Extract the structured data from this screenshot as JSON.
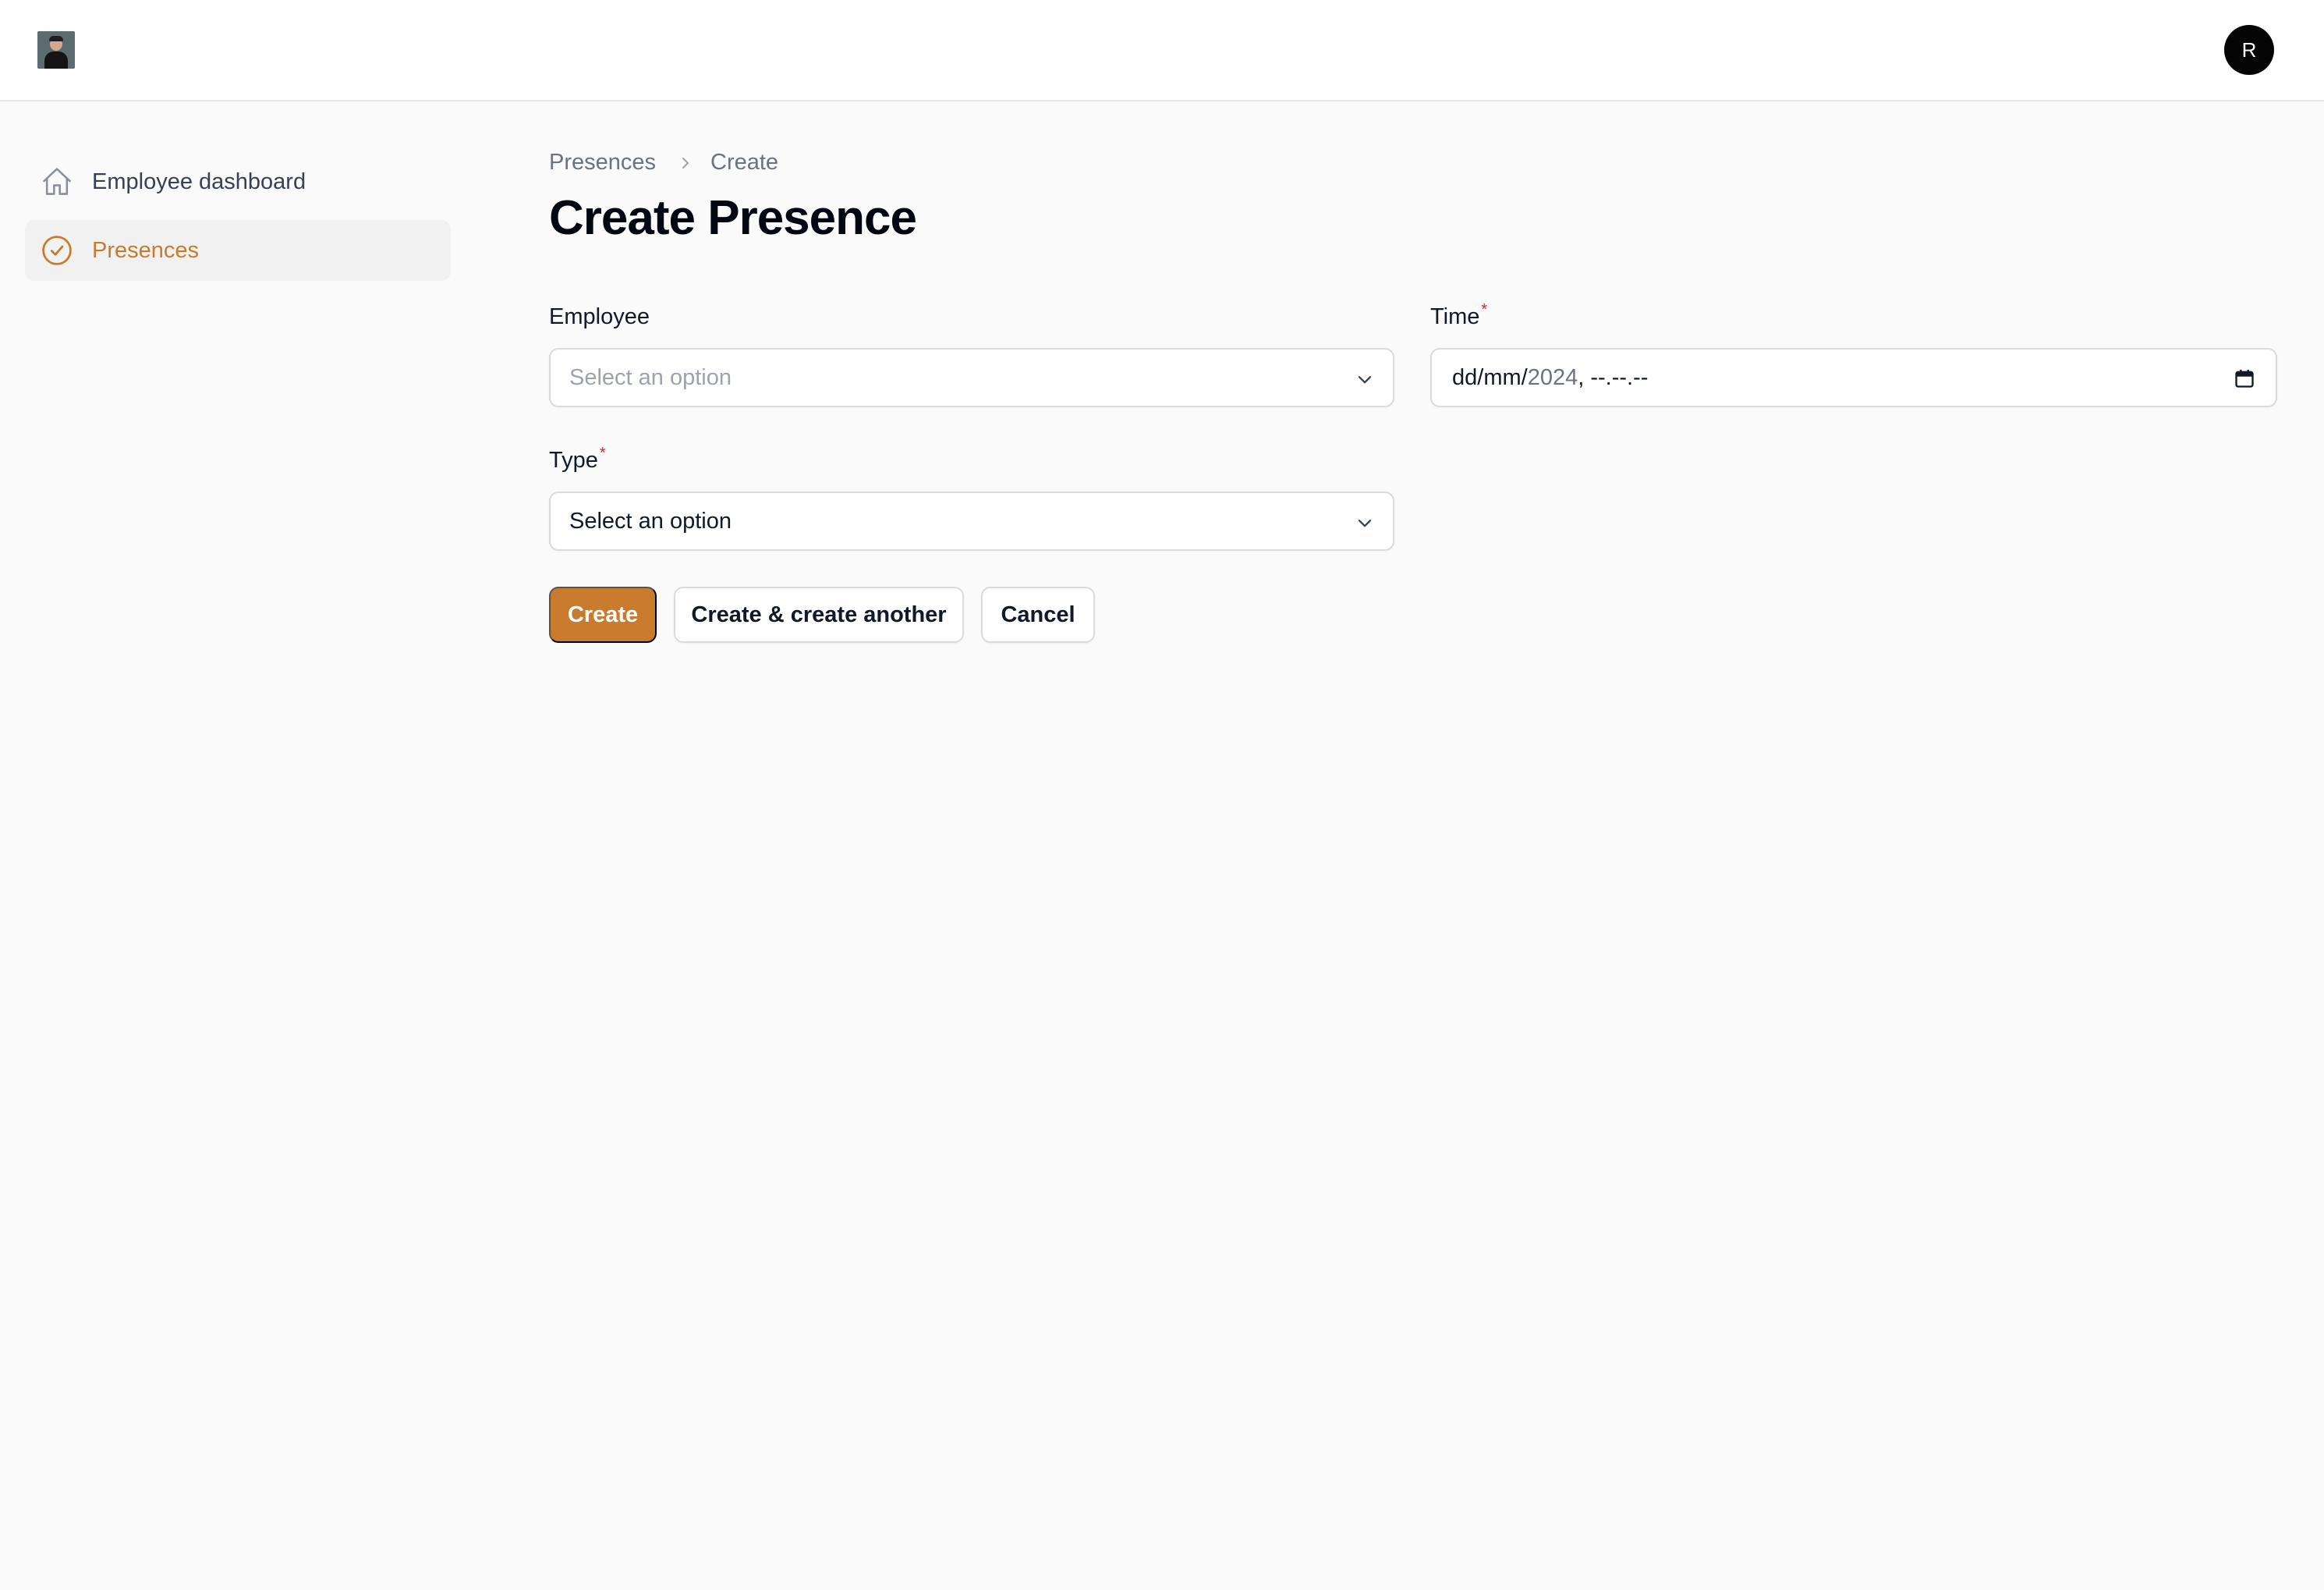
{
  "header": {
    "avatar_initial": "R"
  },
  "sidebar": {
    "items": [
      {
        "label": "Employee dashboard",
        "icon": "home-icon",
        "active": false
      },
      {
        "label": "Presences",
        "icon": "check-circle-icon",
        "active": true
      }
    ]
  },
  "breadcrumb": {
    "items": [
      "Presences",
      "Create"
    ]
  },
  "page": {
    "title": "Create Presence"
  },
  "form": {
    "employee": {
      "label": "Employee",
      "placeholder": "Select an option"
    },
    "time": {
      "label": "Time",
      "required": true,
      "value_prefix": "dd/mm/",
      "value_year": "2024",
      "value_suffix": ", --.--.--"
    },
    "type": {
      "label": "Type",
      "required": true,
      "value": "Select an option"
    },
    "required_marker": "*"
  },
  "actions": {
    "create_label": "Create",
    "create_another_label": "Create & create another",
    "cancel_label": "Cancel"
  },
  "colors": {
    "accent": "#c97b2d",
    "required": "#dc2626",
    "background": "#fafafa"
  }
}
